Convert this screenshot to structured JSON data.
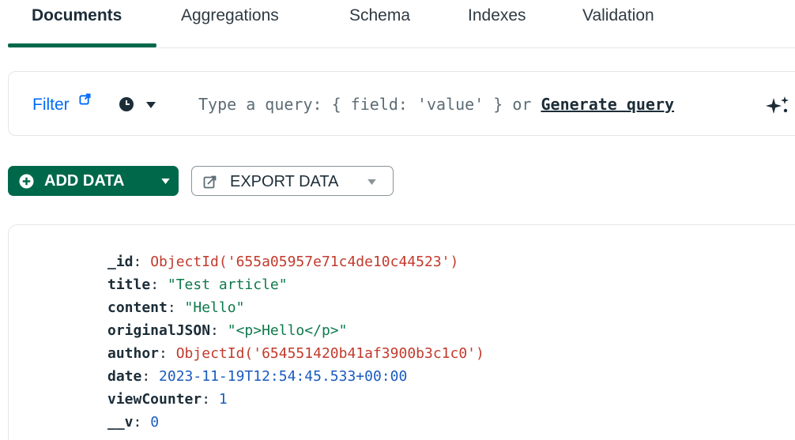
{
  "tabs": [
    {
      "label": "Documents",
      "active": true
    },
    {
      "label": "Aggregations",
      "active": false
    },
    {
      "label": "Schema",
      "active": false
    },
    {
      "label": "Indexes",
      "active": false
    },
    {
      "label": "Validation",
      "active": false
    }
  ],
  "filter": {
    "label": "Filter",
    "placeholder": "Type a query: { field: 'value' } or ",
    "generate_label": "Generate query"
  },
  "toolbar": {
    "add_data_label": "ADD DATA",
    "export_data_label": "EXPORT DATA"
  },
  "document": {
    "fields": [
      {
        "key": "_id",
        "value": "ObjectId('655a05957e71c4de10c44523')",
        "type": "objectid"
      },
      {
        "key": "title",
        "value": "\"Test article\"",
        "type": "string"
      },
      {
        "key": "content",
        "value": "\"Hello\"",
        "type": "string"
      },
      {
        "key": "originalJSON",
        "value": "\"<p>Hello</p>\"",
        "type": "string"
      },
      {
        "key": "author",
        "value": "ObjectId('654551420b41af3900b3c1c0')",
        "type": "objectid"
      },
      {
        "key": "date",
        "value": "2023-11-19T12:54:45.533+00:00",
        "type": "date"
      },
      {
        "key": "viewCounter",
        "value": "1",
        "type": "number"
      },
      {
        "key": "__v",
        "value": "0",
        "type": "number"
      }
    ]
  },
  "colors": {
    "brand_green": "#00684a",
    "link_blue": "#016bf8",
    "objectid_red": "#c23a2c",
    "string_green": "#0d7a4a",
    "number_blue": "#1a5bbf"
  },
  "icons": {
    "filter_link": "external-link-icon",
    "history": "clock-icon",
    "history_caret": "caret-down-icon",
    "generate": "sparkle-icon",
    "add": "plus-circle-icon",
    "export": "export-icon"
  }
}
